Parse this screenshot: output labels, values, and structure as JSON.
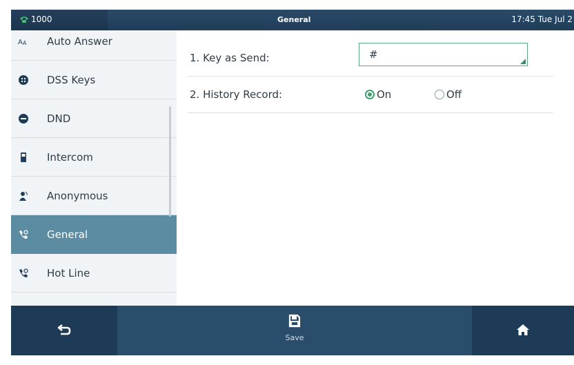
{
  "status": {
    "account": "1000",
    "title": "General",
    "clock": "17:45 Tue Jul 2"
  },
  "sidebar": {
    "items": [
      {
        "label": "Auto Answer",
        "icon": "auto-answer-icon",
        "active": false
      },
      {
        "label": "DSS Keys",
        "icon": "dss-keys-icon",
        "active": false
      },
      {
        "label": "DND",
        "icon": "dnd-icon",
        "active": false
      },
      {
        "label": "Intercom",
        "icon": "intercom-icon",
        "active": false
      },
      {
        "label": "Anonymous",
        "icon": "anonymous-icon",
        "active": false
      },
      {
        "label": "General",
        "icon": "general-icon",
        "active": true
      },
      {
        "label": "Hot Line",
        "icon": "hot-line-icon",
        "active": false
      }
    ]
  },
  "content": {
    "key_as_send": {
      "label": "1. Key as Send:",
      "value": "#"
    },
    "history_record": {
      "label": "2. History Record:",
      "on_label": "On",
      "off_label": "Off",
      "selected": "On"
    }
  },
  "softkeys": {
    "back_icon": "back-icon",
    "save_label": "Save",
    "save_icon": "save-icon",
    "home_icon": "home-icon"
  },
  "colors": {
    "accent_green": "#3ea06c",
    "active_item": "#5c8ca1",
    "bar_navy": "#1d3a56"
  }
}
